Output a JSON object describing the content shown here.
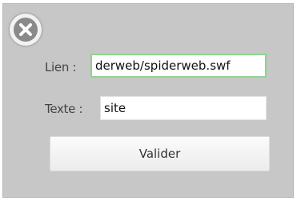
{
  "dialog": {
    "close_icon": "close-icon",
    "link_label": "Lien :",
    "link_value": "derweb/spiderweb.swf",
    "text_label": "Texte :",
    "text_value": "site",
    "submit_label": "Valider"
  },
  "colors": {
    "panel_background": "#c7c7c7",
    "focused_field_border": "#8fd48f"
  }
}
